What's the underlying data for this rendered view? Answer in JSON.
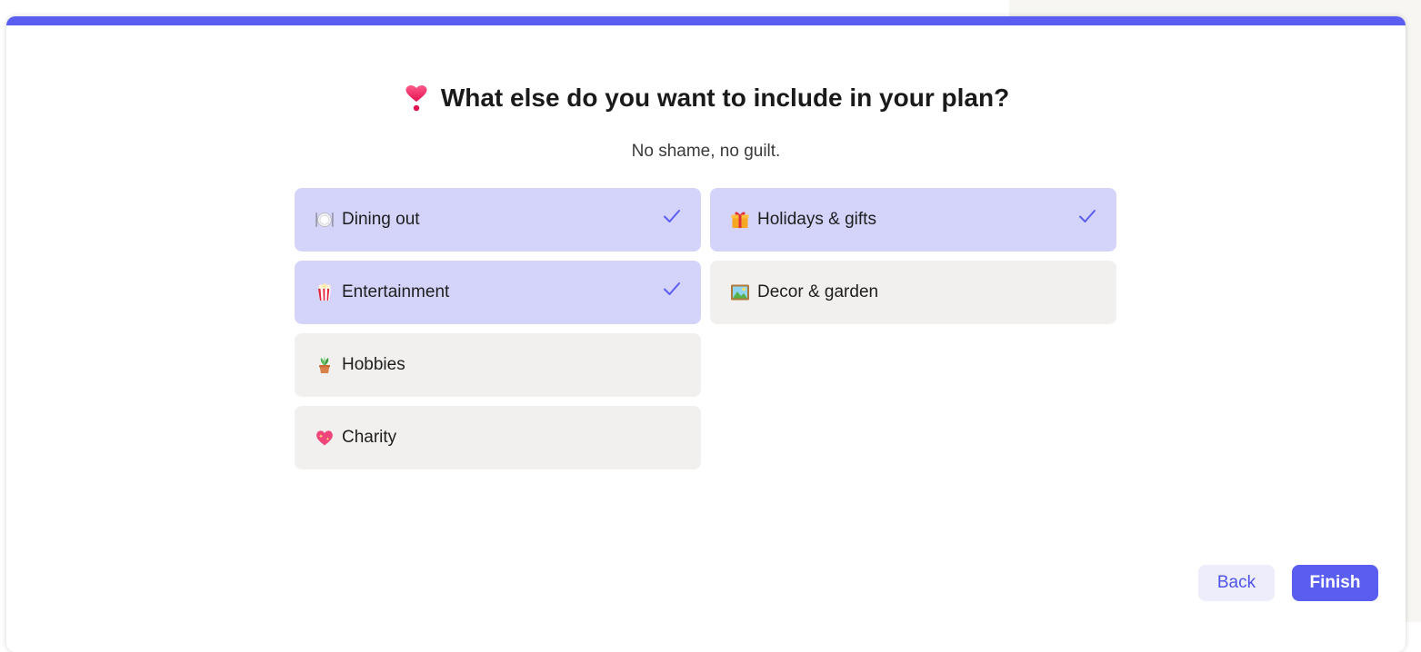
{
  "header": {
    "title": "What else do you want to include in your plan?",
    "title_icon": "heart-exclamation-icon",
    "subtitle": "No shame, no guilt."
  },
  "colors": {
    "accent": "#5a5ef0",
    "selected_bg": "#d4d4fb",
    "unselected_bg": "#f1f0ee",
    "back_bg": "#ededfc"
  },
  "options": [
    {
      "label": "Dining out",
      "icon": "plate-cutlery-icon",
      "selected": true
    },
    {
      "label": "Holidays & gifts",
      "icon": "gift-icon",
      "selected": true
    },
    {
      "label": "Entertainment",
      "icon": "popcorn-icon",
      "selected": true
    },
    {
      "label": "Decor & garden",
      "icon": "framed-picture-icon",
      "selected": false
    },
    {
      "label": "Hobbies",
      "icon": "potted-plant-icon",
      "selected": false
    },
    {
      "label": "Charity",
      "icon": "sparkling-heart-icon",
      "selected": false
    }
  ],
  "footer": {
    "back_label": "Back",
    "finish_label": "Finish"
  }
}
